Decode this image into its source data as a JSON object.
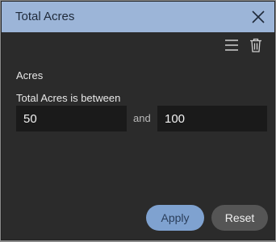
{
  "dialog": {
    "title": "Total Acres"
  },
  "filter": {
    "section_label": "Acres",
    "condition_label": "Total Acres is between",
    "min_value": "50",
    "separator": "and",
    "max_value": "100"
  },
  "buttons": {
    "apply": "Apply",
    "reset": "Reset"
  },
  "icons": {
    "close": "close-icon",
    "menu": "hamburger-menu-icon",
    "delete": "trash-icon"
  },
  "colors": {
    "header": "#9cb5d8",
    "panel": "#2b2b2b",
    "apply": "#7fa2d0",
    "reset": "#555555"
  }
}
